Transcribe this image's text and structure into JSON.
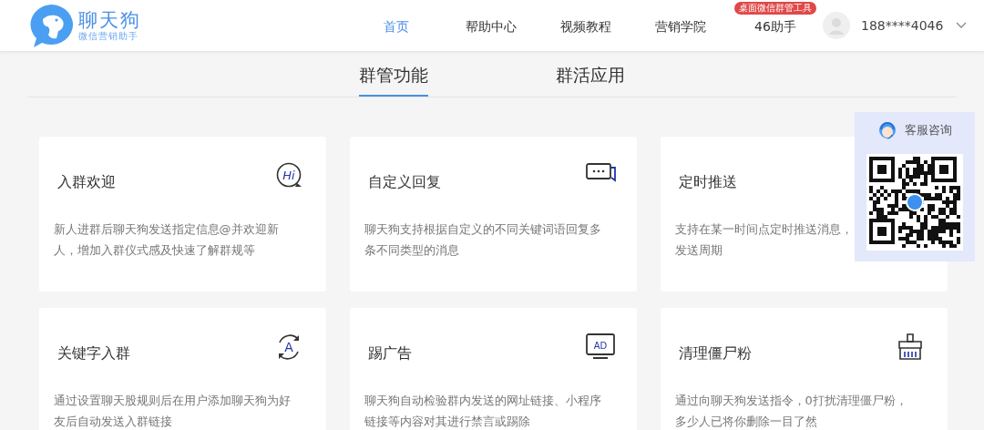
{
  "header": {
    "logo": {
      "name": "聊天狗",
      "tagline": "微信营销助手"
    },
    "nav": [
      {
        "label": "首页",
        "selected": true
      },
      {
        "label": "帮助中心",
        "selected": false
      },
      {
        "label": "视频教程",
        "selected": false
      },
      {
        "label": "营销学院",
        "selected": false
      },
      {
        "label": "46助手",
        "selected": false,
        "badge": "桌面微信群管工具"
      }
    ],
    "user": {
      "phone": "188****4046"
    }
  },
  "tabs": [
    {
      "label": "群管功能",
      "selected": true
    },
    {
      "label": "群活应用",
      "selected": false
    }
  ],
  "cards": [
    {
      "title": "入群欢迎",
      "kind": "hi",
      "icon_text": "Hi",
      "description": [
        "新人进群后聊天狗发送指定信息@并欢迎新",
        "人，增加入群仪式感及快速了解群规等"
      ]
    },
    {
      "title": "自定义回复",
      "kind": "chat",
      "description": [
        "聊天狗支持根据自定义的不同关键词语回复多",
        "条不同类型的消息"
      ]
    },
    {
      "title": "定时推送",
      "description": [
        "支持在某一时间点定时推送消息，",
        "发送周期"
      ]
    },
    {
      "title": "关键字入群",
      "kind": "letter",
      "icon_text": "A",
      "description": [
        "通过设置聊天股规则后在用户添加聊天狗为好",
        "友后自动发送入群链接"
      ]
    },
    {
      "title": "踢广告",
      "kind": "ad",
      "icon_text": "AD",
      "description": [
        "聊天狗自动检验群内发送的网址链接、小程序",
        "链接等内容对其进行禁言或踢除"
      ]
    },
    {
      "title": "清理僵尸粉",
      "kind": "brush",
      "description": [
        "通过向聊天狗发送指令，0打扰清理僵尸粉，",
        "多少人已将你删除一目了然"
      ]
    }
  ],
  "support": {
    "title": "客服咨询"
  }
}
